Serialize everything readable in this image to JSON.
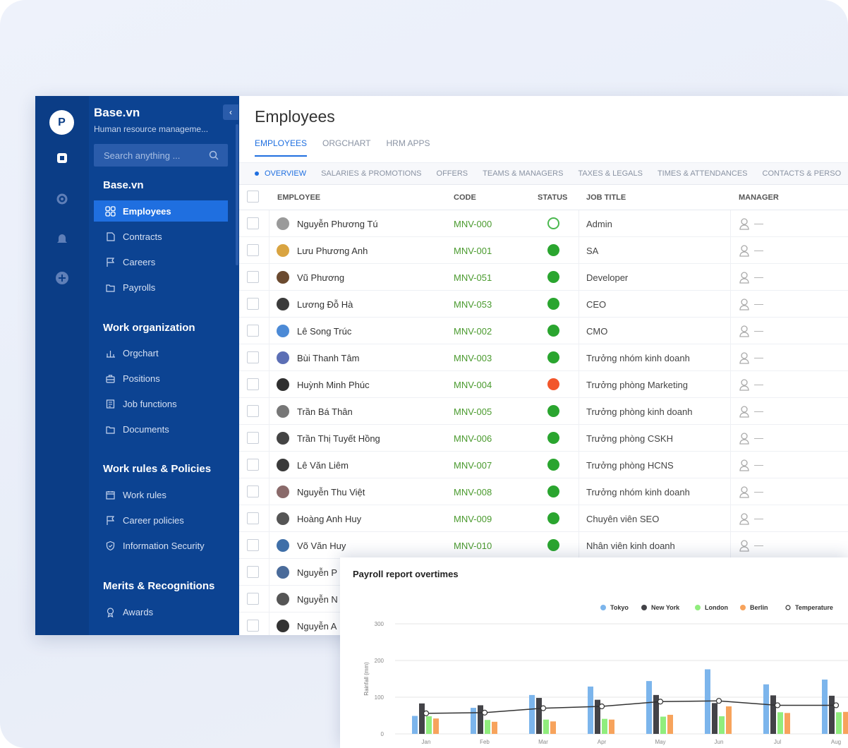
{
  "app": {
    "brand_title": "Base.vn",
    "brand_subtitle": "Human resource manageme...",
    "collapse_label": "‹",
    "avatar_letter": "P",
    "search_placeholder": "Search anything ..."
  },
  "sidebar": {
    "section_main": "Base.vn",
    "main_items": [
      {
        "label": "Employees",
        "icon": "grid-icon",
        "active": true
      },
      {
        "label": "Contracts",
        "icon": "contract-icon"
      },
      {
        "label": "Careers",
        "icon": "flag-icon"
      },
      {
        "label": "Payrolls",
        "icon": "folder-icon"
      }
    ],
    "section_work": "Work organization",
    "work_items": [
      {
        "label": "Orgchart",
        "icon": "orgchart-icon"
      },
      {
        "label": "Positions",
        "icon": "briefcase-icon"
      },
      {
        "label": "Job functions",
        "icon": "document-icon"
      },
      {
        "label": "Documents",
        "icon": "folder-icon"
      }
    ],
    "section_rules": "Work rules & Policies",
    "rules_items": [
      {
        "label": "Work rules",
        "icon": "calendar-icon"
      },
      {
        "label": "Career policies",
        "icon": "flag-icon"
      },
      {
        "label": "Information Security",
        "icon": "shield-icon"
      }
    ],
    "section_merits": "Merits & Recognitions",
    "merits_items": [
      {
        "label": "Awards",
        "icon": "award-icon"
      }
    ]
  },
  "main": {
    "title": "Employees",
    "tabs": [
      "EMPLOYEES",
      "ORGCHART",
      "HRM APPS"
    ],
    "subtabs": [
      "OVERVIEW",
      "SALARIES & PROMOTIONS",
      "OFFERS",
      "TEAMS & MANAGERS",
      "TAXES & LEGALS",
      "TIMES & ATTENDANCES",
      "CONTACTS & PERSO"
    ],
    "columns": {
      "employee": "EMPLOYEE",
      "code": "CODE",
      "status": "STATUS",
      "job": "JOB TITLE",
      "manager": "MANAGER"
    }
  },
  "employees": [
    {
      "name": "Nguyễn Phương Tú",
      "code": "MNV-000",
      "status": "inactive",
      "job": "Admin"
    },
    {
      "name": "Lưu Phương Anh",
      "code": "MNV-001",
      "status": "active",
      "job": "SA"
    },
    {
      "name": "Vũ Phương",
      "code": "MNV-051",
      "status": "active",
      "job": "Developer"
    },
    {
      "name": "Lương Đỗ Hà",
      "code": "MNV-053",
      "status": "active",
      "job": "CEO"
    },
    {
      "name": "Lê Song Trúc",
      "code": "MNV-002",
      "status": "active",
      "job": "CMO"
    },
    {
      "name": "Bùi Thanh Tâm",
      "code": "MNV-003",
      "status": "active",
      "job": "Trưởng nhóm kinh doanh"
    },
    {
      "name": "Huỳnh Minh Phúc",
      "code": "MNV-004",
      "status": "warning",
      "job": "Trưởng phòng Marketing"
    },
    {
      "name": "Trần Bá Thân",
      "code": "MNV-005",
      "status": "active",
      "job": "Trưởng phòng kinh doanh"
    },
    {
      "name": "Trần Thị Tuyết Hồng",
      "code": "MNV-006",
      "status": "active",
      "job": "Trưởng phòng CSKH"
    },
    {
      "name": "Lê Văn Liêm",
      "code": "MNV-007",
      "status": "active",
      "job": "Trưởng phòng HCNS"
    },
    {
      "name": "Nguyễn Thu Việt",
      "code": "MNV-008",
      "status": "active",
      "job": "Trưởng nhóm kinh doanh"
    },
    {
      "name": "Hoàng Anh Huy",
      "code": "MNV-009",
      "status": "active",
      "job": "Chuyên viên SEO"
    },
    {
      "name": "Võ Văn Huy",
      "code": "MNV-010",
      "status": "active",
      "job": "Nhân viên kinh doanh"
    },
    {
      "name": "Nguyễn P",
      "code": "",
      "status": "",
      "job": ""
    },
    {
      "name": "Nguyễn N",
      "code": "",
      "status": "",
      "job": ""
    },
    {
      "name": "Nguyễn A",
      "code": "",
      "status": "",
      "job": ""
    }
  ],
  "manager_placeholder": "—",
  "colors": {
    "active": "#2aa52f",
    "warning": "#f2562b",
    "inactive_border": "#4bb84f",
    "accent": "#1f6fe0",
    "sidebar": "#0c4392"
  },
  "chart_data": {
    "type": "bar",
    "title": "Payroll report overtimes",
    "ylabel": "Rainfall (mm)",
    "ylim": [
      0,
      300
    ],
    "yticks": [
      0,
      100,
      200,
      300
    ],
    "categories": [
      "Jan",
      "Feb",
      "Mar",
      "Apr",
      "May",
      "Jun",
      "Jul",
      "Aug"
    ],
    "legend_position": "top-right",
    "series": [
      {
        "name": "Tokyo",
        "color": "#7cb5ec",
        "values": [
          49,
          71,
          106,
          129,
          144,
          176,
          135,
          148
        ]
      },
      {
        "name": "New York",
        "color": "#434348",
        "values": [
          83,
          78,
          98,
          93,
          106,
          84,
          105,
          104
        ]
      },
      {
        "name": "London",
        "color": "#90ed7d",
        "values": [
          48,
          38,
          39,
          41,
          47,
          48,
          59,
          59
        ]
      },
      {
        "name": "Berlin",
        "color": "#f7a35c",
        "values": [
          42,
          33,
          34,
          39,
          52,
          75,
          57,
          60
        ]
      },
      {
        "name": "Temperature",
        "color": "#333333",
        "kind": "line",
        "values": [
          56,
          58,
          70,
          75,
          88,
          90,
          78,
          78
        ]
      }
    ]
  }
}
